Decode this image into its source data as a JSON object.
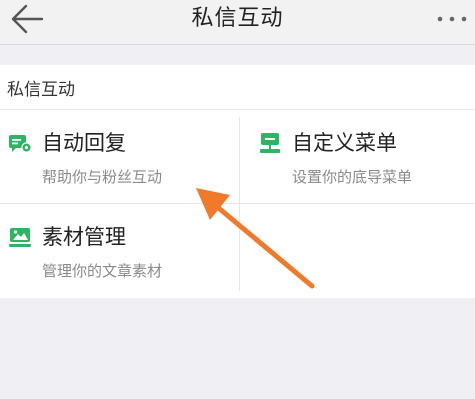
{
  "header": {
    "title": "私信互动",
    "back_icon": "arrow-left-icon",
    "more_icon": "more-dots-icon"
  },
  "section": {
    "title": "私信互动"
  },
  "items": [
    {
      "title": "自动回复",
      "subtitle": "帮助你与粉丝互动",
      "icon": "auto-reply-icon"
    },
    {
      "title": "自定义菜单",
      "subtitle": "设置你的底导菜单",
      "icon": "custom-menu-icon"
    },
    {
      "title": "素材管理",
      "subtitle": "管理你的文章素材",
      "icon": "material-icon"
    }
  ],
  "colors": {
    "icon_green": "#2fb463",
    "annotation_arrow": "#f07a2a",
    "page_background": "#efeff4"
  }
}
